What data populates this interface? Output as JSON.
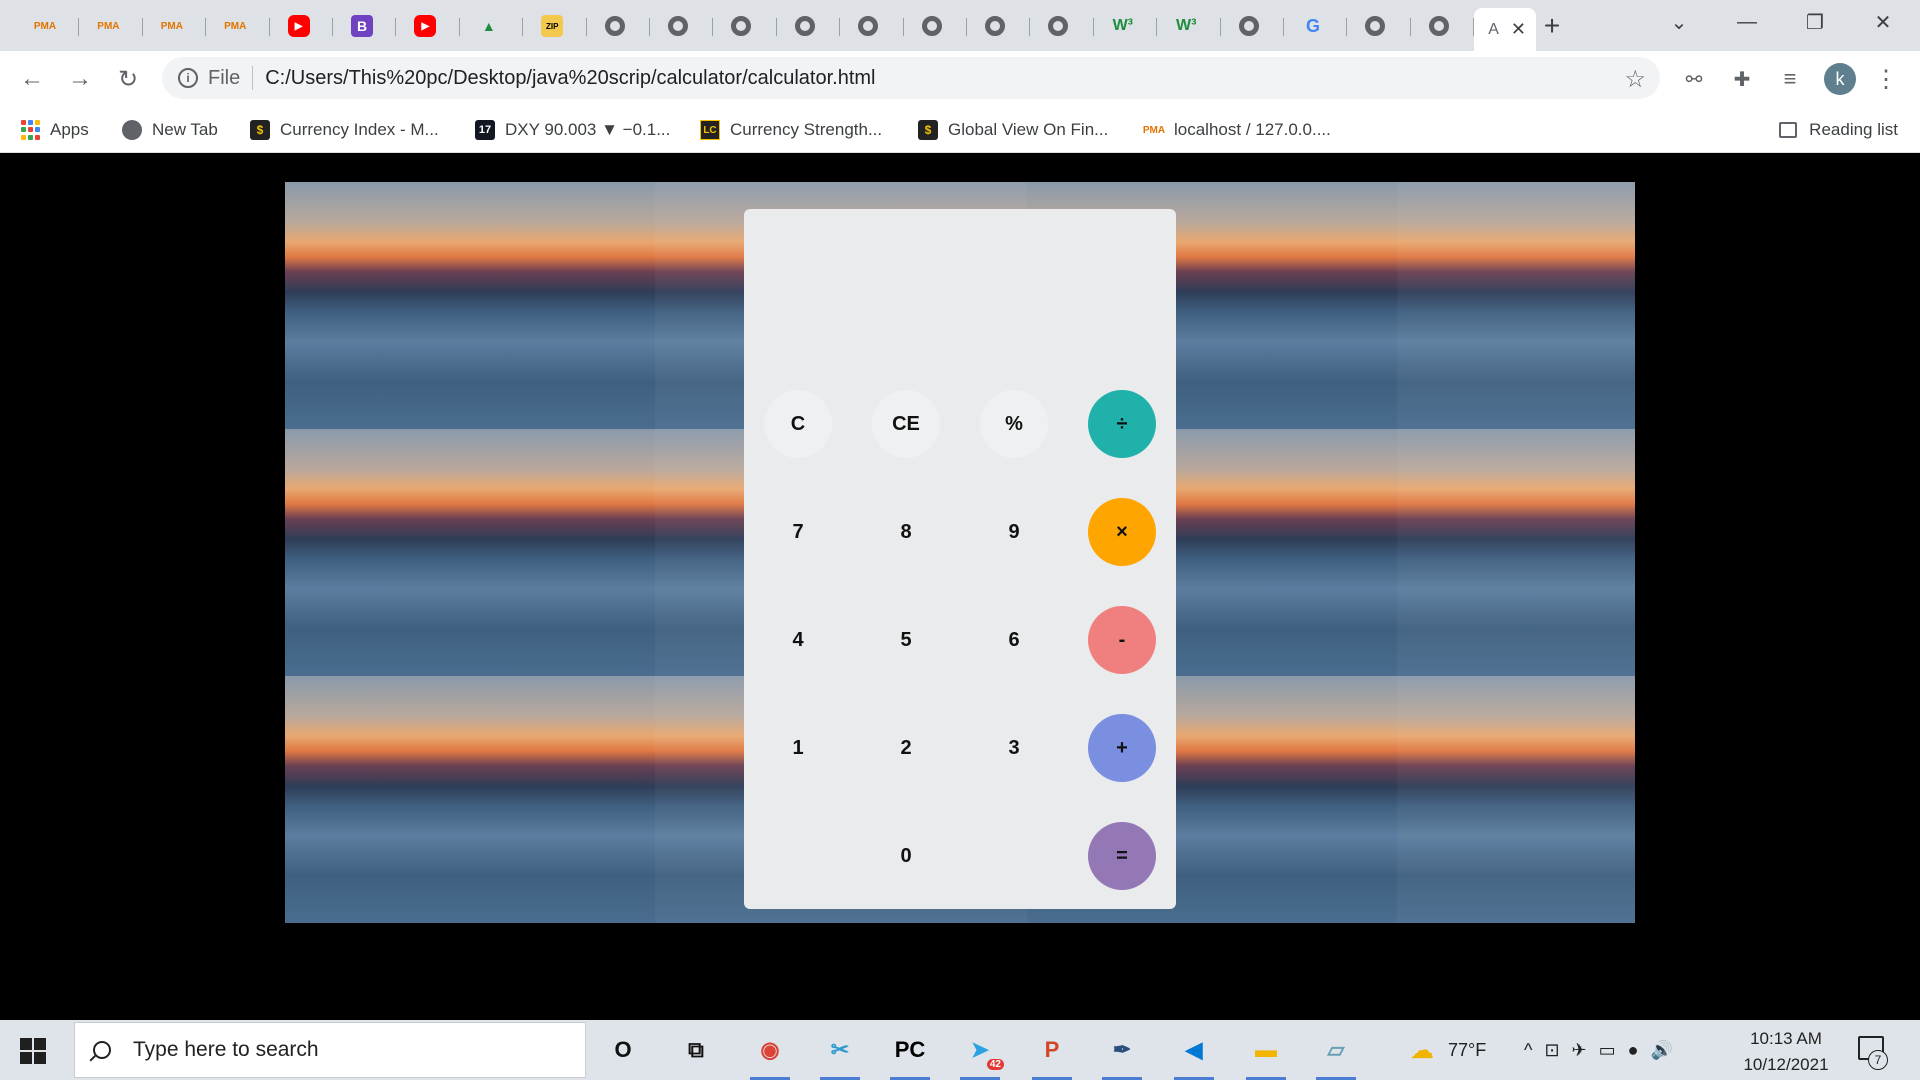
{
  "browser": {
    "tabs": [
      {
        "icon": "pma-icon",
        "glyph": "PMA"
      },
      {
        "icon": "pma-icon",
        "glyph": "PMA"
      },
      {
        "icon": "pma-icon",
        "glyph": "PMA"
      },
      {
        "icon": "pma-icon",
        "glyph": "PMA"
      },
      {
        "icon": "youtube-icon",
        "glyph": "▶"
      },
      {
        "icon": "bootstrap-icon",
        "glyph": "B"
      },
      {
        "icon": "youtube-icon",
        "glyph": "▶"
      },
      {
        "icon": "google-drive-icon",
        "glyph": "▲"
      },
      {
        "icon": "zip-icon",
        "glyph": "ZIP"
      },
      {
        "icon": "globe-icon",
        "glyph": ""
      },
      {
        "icon": "globe-icon",
        "glyph": ""
      },
      {
        "icon": "globe-icon",
        "glyph": ""
      },
      {
        "icon": "globe-icon",
        "glyph": ""
      },
      {
        "icon": "globe-icon",
        "glyph": ""
      },
      {
        "icon": "globe-icon",
        "glyph": ""
      },
      {
        "icon": "globe-icon",
        "glyph": ""
      },
      {
        "icon": "globe-icon",
        "glyph": ""
      },
      {
        "icon": "w3schools-icon",
        "glyph": "W³"
      },
      {
        "icon": "w3schools-icon",
        "glyph": "W³"
      },
      {
        "icon": "globe-icon",
        "glyph": ""
      },
      {
        "icon": "google-icon",
        "glyph": "G"
      },
      {
        "icon": "globe-icon",
        "glyph": ""
      },
      {
        "icon": "globe-icon",
        "glyph": ""
      }
    ],
    "active_tab": {
      "title": "A",
      "close_glyph": "✕"
    },
    "new_tab_glyph": "+",
    "window_controls": {
      "tab_search": "⌄",
      "minimize": "—",
      "restore": "❐",
      "close": "✕"
    },
    "nav": {
      "back": "←",
      "forward": "→",
      "reload": "↻"
    },
    "omnibox": {
      "info_glyph": "i",
      "scheme_label": "File",
      "url": "C:/Users/This%20pc/Desktop/java%20scrip/calculator/calculator.html",
      "star_glyph": "☆"
    },
    "toolbar_right": {
      "extension1": "⚯",
      "extensions": "✚",
      "media": "≡",
      "avatar_letter": "k",
      "menu": "⋮"
    },
    "bookmarks": [
      {
        "label": "Apps",
        "icon": "apps-icon"
      },
      {
        "label": "New Tab",
        "icon": "globe-icon"
      },
      {
        "label": "Currency Index - M...",
        "icon": "dollar-icon",
        "glyph": "$"
      },
      {
        "label": "DXY 90.003 ▼ −0.1...",
        "icon": "tradingview-icon",
        "glyph": "17"
      },
      {
        "label": "Currency Strength...",
        "icon": "lc-icon",
        "glyph": "LC"
      },
      {
        "label": "Global View On Fin...",
        "icon": "dollar-icon",
        "glyph": "$"
      },
      {
        "label": "localhost / 127.0.0....",
        "icon": "pma-icon",
        "glyph": "PMA"
      }
    ],
    "reading_list_label": "Reading list"
  },
  "calculator": {
    "display_value": "",
    "keys": [
      {
        "label": "C",
        "name": "clear-button",
        "style": "light"
      },
      {
        "label": "CE",
        "name": "clear-entry-button",
        "style": "light"
      },
      {
        "label": "%",
        "name": "percent-button",
        "style": "light"
      },
      {
        "label": "÷",
        "name": "divide-button",
        "style": "op-div"
      },
      {
        "label": "7",
        "name": "digit-7-button",
        "style": "plain"
      },
      {
        "label": "8",
        "name": "digit-8-button",
        "style": "plain"
      },
      {
        "label": "9",
        "name": "digit-9-button",
        "style": "plain"
      },
      {
        "label": "×",
        "name": "multiply-button",
        "style": "op-mul"
      },
      {
        "label": "4",
        "name": "digit-4-button",
        "style": "plain"
      },
      {
        "label": "5",
        "name": "digit-5-button",
        "style": "plain"
      },
      {
        "label": "6",
        "name": "digit-6-button",
        "style": "plain"
      },
      {
        "label": "-",
        "name": "subtract-button",
        "style": "op-sub"
      },
      {
        "label": "1",
        "name": "digit-1-button",
        "style": "plain"
      },
      {
        "label": "2",
        "name": "digit-2-button",
        "style": "plain"
      },
      {
        "label": "3",
        "name": "digit-3-button",
        "style": "plain"
      },
      {
        "label": "+",
        "name": "add-button",
        "style": "op-add"
      },
      {
        "label": "0",
        "name": "digit-0-button",
        "style": "plain"
      },
      {
        "label": "=",
        "name": "equals-button",
        "style": "op-eq"
      }
    ],
    "colors": {
      "divide": "#20b2aa",
      "multiply": "#ffa500",
      "subtract": "#f08080",
      "add": "#7b8fe0",
      "equals": "#9477b5"
    }
  },
  "taskbar": {
    "search_placeholder": "Type here to search",
    "apps": [
      {
        "icon": "cortana-icon",
        "glyph": "O"
      },
      {
        "icon": "task-view-icon",
        "glyph": "⧉"
      },
      {
        "icon": "chrome-icon",
        "glyph": "◉"
      },
      {
        "icon": "snipping-tool-icon",
        "glyph": "✂"
      },
      {
        "icon": "pycharm-icon",
        "glyph": "PC"
      },
      {
        "icon": "telegram-icon",
        "glyph": "➤",
        "badge": "42"
      },
      {
        "icon": "powerpoint-icon",
        "glyph": "P"
      },
      {
        "icon": "quill-icon",
        "glyph": "✒"
      },
      {
        "icon": "vscode-icon",
        "glyph": "◀"
      },
      {
        "icon": "file-explorer-icon",
        "glyph": "▬"
      },
      {
        "icon": "notes-icon",
        "glyph": "▱"
      }
    ],
    "weather": "77°F",
    "tray_glyphs": [
      "^",
      "⊡",
      "✈",
      "▭",
      "●",
      "🔊"
    ],
    "time": "10:13 AM",
    "date": "10/12/2021",
    "notification_count": "7"
  }
}
